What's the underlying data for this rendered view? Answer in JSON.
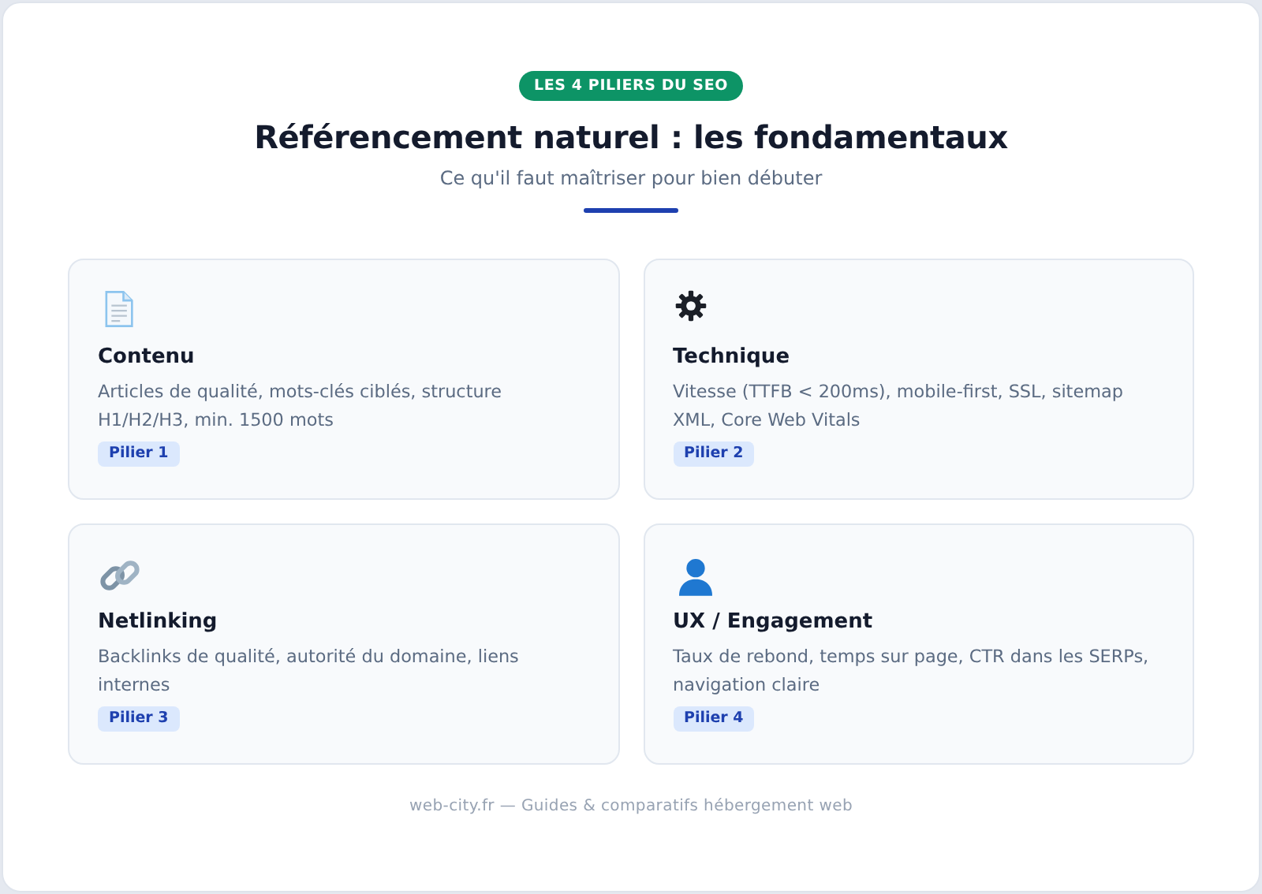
{
  "header": {
    "badge": "LES 4 PILIERS DU SEO",
    "title": "Référencement naturel : les fondamentaux",
    "subtitle": "Ce qu'il faut maîtriser pour bien débuter"
  },
  "cards": [
    {
      "kind": "document",
      "title": "Contenu",
      "description": "Articles de qualité, mots-clés ciblés, structure H1/H2/H3, min. 1500 mots",
      "tag": "Pilier 1"
    },
    {
      "kind": "gear",
      "title": "Technique",
      "description": "Vitesse (TTFB < 200ms), mobile-first, SSL, sitemap XML, Core Web Vitals",
      "tag": "Pilier 2"
    },
    {
      "kind": "link",
      "title": "Netlinking",
      "description": "Backlinks de qualité, autorité du domaine, liens internes",
      "tag": "Pilier 3"
    },
    {
      "kind": "person",
      "title": "UX / Engagement",
      "description": "Taux de rebond, temps sur page, CTR dans les SERPs, navigation claire",
      "tag": "Pilier 4"
    }
  ],
  "footer": "web-city.fr — Guides & comparatifs hébergement web"
}
